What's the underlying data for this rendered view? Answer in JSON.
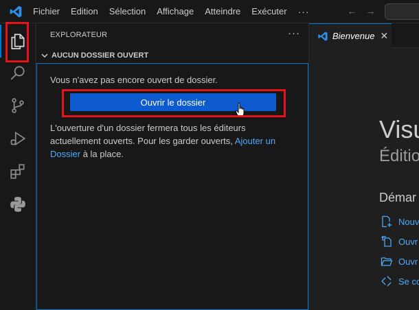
{
  "colors": {
    "accent": "#0078d4",
    "button": "#0e5bd1",
    "link": "#4daafc",
    "highlight": "#e5141c"
  },
  "titlebar": {
    "logo_icon": "vscode-logo",
    "menu": [
      "Fichier",
      "Edition",
      "Sélection",
      "Affichage",
      "Atteindre",
      "Exécuter"
    ],
    "more": "···",
    "back_icon": "arrow-left-icon",
    "forward_icon": "arrow-right-icon"
  },
  "activity_bar": {
    "items": [
      "explorer-icon",
      "search-icon",
      "source-control-icon",
      "run-debug-icon",
      "extensions-icon",
      "python-icon"
    ],
    "active": "explorer-icon"
  },
  "sidebar": {
    "title": "EXPLORATEUR",
    "more": "···",
    "section": "AUCUN DOSSIER OUVERT",
    "message": "Vous n'avez pas encore ouvert de dossier.",
    "open_button": "Ouvrir le dossier",
    "note_prefix": "L'ouverture d'un dossier fermera tous les éditeurs actuellement ouverts. Pour les garder ouverts, ",
    "note_link": "Ajouter un Dossier",
    "note_suffix": " à la place."
  },
  "editor": {
    "tab_label": "Bienvenue",
    "tab_close": "✕",
    "welcome_title": "Visu",
    "welcome_subtitle": "Éditio",
    "start_heading": "Démar",
    "start_items": [
      "Nouv",
      "Ouvr",
      "Ouvr",
      "Se co"
    ]
  }
}
